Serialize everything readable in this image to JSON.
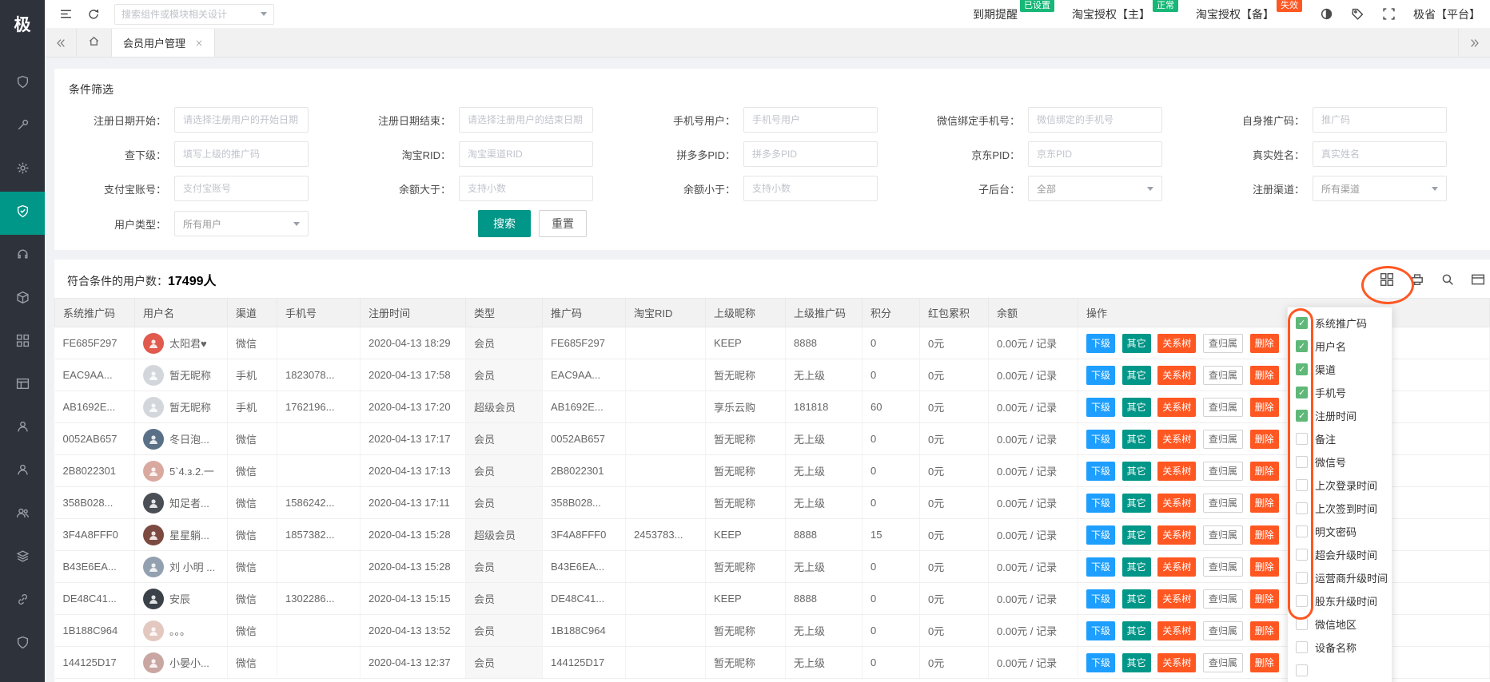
{
  "app": {
    "logo_text": "极",
    "brand": "极省【平台】"
  },
  "topbar": {
    "search_placeholder": "搜索组件或模块相关设计",
    "reminder": {
      "label": "到期提醒",
      "badge": "已设置",
      "badge_color": "#16b777"
    },
    "taobao_main": {
      "label": "淘宝授权【主】",
      "badge": "正常",
      "badge_color": "#16b777"
    },
    "taobao_backup": {
      "label": "淘宝授权【备】",
      "badge": "失效",
      "badge_color": "#ff5722"
    }
  },
  "tabbar": {
    "active_tab": "会员用户管理"
  },
  "filter": {
    "title": "条件筛选",
    "search_label": "搜索",
    "reset_label": "重置",
    "fields": [
      {
        "label": "注册日期开始：",
        "placeholder": "请选择注册用户的开始日期"
      },
      {
        "label": "注册日期结束：",
        "placeholder": "请选择注册用户的结束日期"
      },
      {
        "label": "手机号用户：",
        "placeholder": "手机号用户"
      },
      {
        "label": "微信绑定手机号：",
        "placeholder": "微信绑定的手机号"
      },
      {
        "label": "自身推广码：",
        "placeholder": "推广码"
      },
      {
        "label": "查下级：",
        "placeholder": "填写上级的推广码"
      },
      {
        "label": "淘宝RID：",
        "placeholder": "淘宝渠道RID"
      },
      {
        "label": "拼多多PID：",
        "placeholder": "拼多多PID"
      },
      {
        "label": "京东PID：",
        "placeholder": "京东PID"
      },
      {
        "label": "真实姓名：",
        "placeholder": "真实姓名"
      },
      {
        "label": "支付宝账号：",
        "placeholder": "支付宝账号"
      },
      {
        "label": "余额大于：",
        "placeholder": "支持小数"
      },
      {
        "label": "余额小于：",
        "placeholder": "支持小数"
      },
      {
        "label": "子后台：",
        "value": "全部"
      },
      {
        "label": "注册渠道：",
        "value": "所有渠道"
      },
      {
        "label": "用户类型：",
        "value": "所有用户"
      }
    ]
  },
  "summary": {
    "prefix": "符合条件的用户数：",
    "count": "17499人"
  },
  "table": {
    "headers": [
      "系统推广码",
      "用户名",
      "渠道",
      "手机号",
      "注册时间",
      "类型",
      "推广码",
      "淘宝RID",
      "上级昵称",
      "上级推广码",
      "积分",
      "红包累积",
      "余额",
      "操作"
    ],
    "actions": [
      "下级",
      "其它",
      "关系树",
      "查归属",
      "删除"
    ],
    "rows": [
      {
        "code": "FE685F297",
        "name": "太阳君♥",
        "avatar_color": "#e05a4e",
        "channel": "微信",
        "phone": "",
        "reg_time": "2020-04-13 18:29",
        "type": "会员",
        "promo": "FE685F297",
        "taobao_rid": "",
        "parent_name": "KEEP",
        "parent_code": "8888",
        "points": "0",
        "red_packet": "0元",
        "balance": "0.00元 / 记录"
      },
      {
        "code": "EAC9AA...",
        "name": "暂无昵称",
        "avatar_color": "#d3d7dc",
        "channel": "手机",
        "phone": "1823078...",
        "reg_time": "2020-04-13 17:58",
        "type": "会员",
        "promo": "EAC9AA...",
        "taobao_rid": "",
        "parent_name": "暂无昵称",
        "parent_code": "无上级",
        "points": "0",
        "red_packet": "0元",
        "balance": "0.00元 / 记录"
      },
      {
        "code": "AB1692E...",
        "name": "暂无昵称",
        "avatar_color": "#d3d7dc",
        "channel": "手机",
        "phone": "1762196...",
        "reg_time": "2020-04-13 17:20",
        "type": "超级会员",
        "promo": "AB1692E...",
        "taobao_rid": "",
        "parent_name": "享乐云购",
        "parent_code": "181818",
        "points": "60",
        "red_packet": "0元",
        "balance": "0.00元 / 记录"
      },
      {
        "code": "0052AB657",
        "name": "冬日泡...",
        "avatar_color": "#5a7086",
        "channel": "微信",
        "phone": "",
        "reg_time": "2020-04-13 17:17",
        "type": "会员",
        "promo": "0052AB657",
        "taobao_rid": "",
        "parent_name": "暂无昵称",
        "parent_code": "无上级",
        "points": "0",
        "red_packet": "0元",
        "balance": "0.00元 / 记录"
      },
      {
        "code": "2B8022301",
        "name": "5`4.з.2.一",
        "avatar_color": "#d9a9a0",
        "channel": "微信",
        "phone": "",
        "reg_time": "2020-04-13 17:13",
        "type": "会员",
        "promo": "2B8022301",
        "taobao_rid": "",
        "parent_name": "暂无昵称",
        "parent_code": "无上级",
        "points": "0",
        "red_packet": "0元",
        "balance": "0.00元 / 记录"
      },
      {
        "code": "358B028...",
        "name": "知足者...",
        "avatar_color": "#4a4e55",
        "channel": "微信",
        "phone": "1586242...",
        "reg_time": "2020-04-13 17:11",
        "type": "会员",
        "promo": "358B028...",
        "taobao_rid": "",
        "parent_name": "暂无昵称",
        "parent_code": "无上级",
        "points": "0",
        "red_packet": "0元",
        "balance": "0.00元 / 记录"
      },
      {
        "code": "3F4A8FFF0",
        "name": "星星躺...",
        "avatar_color": "#7c4a40",
        "channel": "微信",
        "phone": "1857382...",
        "reg_time": "2020-04-13 15:28",
        "type": "超级会员",
        "promo": "3F4A8FFF0",
        "taobao_rid": "2453783...",
        "parent_name": "KEEP",
        "parent_code": "8888",
        "points": "15",
        "red_packet": "0元",
        "balance": "0.00元 / 记录"
      },
      {
        "code": "B43E6EA...",
        "name": "刘 小明 ...",
        "avatar_color": "#93a0b0",
        "channel": "微信",
        "phone": "",
        "reg_time": "2020-04-13 15:28",
        "type": "会员",
        "promo": "B43E6EA...",
        "taobao_rid": "",
        "parent_name": "暂无昵称",
        "parent_code": "无上级",
        "points": "0",
        "red_packet": "0元",
        "balance": "0.00元 / 记录"
      },
      {
        "code": "DE48C41...",
        "name": "安辰",
        "avatar_color": "#3b4148",
        "channel": "微信",
        "phone": "1302286...",
        "reg_time": "2020-04-13 15:15",
        "type": "会员",
        "promo": "DE48C41...",
        "taobao_rid": "",
        "parent_name": "KEEP",
        "parent_code": "8888",
        "points": "0",
        "red_packet": "0元",
        "balance": "0.00元 / 记录"
      },
      {
        "code": "1B188C964",
        "name": "。。。",
        "avatar_color": "#e3c8c0",
        "channel": "微信",
        "phone": "",
        "reg_time": "2020-04-13 13:52",
        "type": "会员",
        "promo": "1B188C964",
        "taobao_rid": "",
        "parent_name": "暂无昵称",
        "parent_code": "无上级",
        "points": "0",
        "red_packet": "0元",
        "balance": "0.00元 / 记录"
      },
      {
        "code": "144125D17",
        "name": "小晏小...",
        "avatar_color": "#c9a6a2",
        "channel": "微信",
        "phone": "",
        "reg_time": "2020-04-13 12:37",
        "type": "会员",
        "promo": "144125D17",
        "taobao_rid": "",
        "parent_name": "暂无昵称",
        "parent_code": "无上级",
        "points": "0",
        "red_packet": "0元",
        "balance": "0.00元 / 记录"
      }
    ]
  },
  "column_picker": {
    "items": [
      {
        "label": "系统推广码",
        "checked": true
      },
      {
        "label": "用户名",
        "checked": true
      },
      {
        "label": "渠道",
        "checked": true
      },
      {
        "label": "手机号",
        "checked": true
      },
      {
        "label": "注册时间",
        "checked": true
      },
      {
        "label": "备注",
        "checked": false
      },
      {
        "label": "微信号",
        "checked": false
      },
      {
        "label": "上次登录时间",
        "checked": false
      },
      {
        "label": "上次签到时间",
        "checked": false
      },
      {
        "label": "明文密码",
        "checked": false
      },
      {
        "label": "超会升级时间",
        "checked": false
      },
      {
        "label": "运营商升级时间",
        "checked": false
      },
      {
        "label": "股东升级时间",
        "checked": false
      },
      {
        "label": "微信地区",
        "checked": false
      },
      {
        "label": "设备名称",
        "checked": false
      },
      {
        "label": "",
        "checked": false
      }
    ]
  },
  "colors": {
    "accent": "#009688",
    "annotation": "#ff5722",
    "checkbox_on": "#5FB878"
  }
}
